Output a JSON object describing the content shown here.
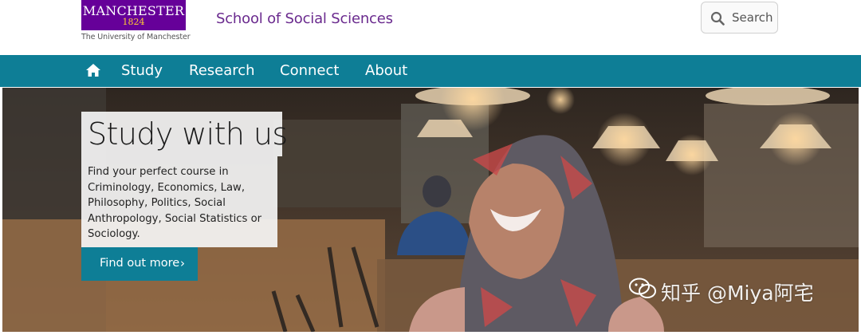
{
  "header": {
    "logo": {
      "wordmark": "MANCHESTER",
      "year": "1824",
      "subtitle": "The University of Manchester"
    },
    "school_name": "School of Social Sciences",
    "search": {
      "label": "Search",
      "icon": "search-icon"
    }
  },
  "nav": {
    "home_icon": "home-icon",
    "items": [
      {
        "label": "Study"
      },
      {
        "label": "Research"
      },
      {
        "label": "Connect"
      },
      {
        "label": "About"
      }
    ]
  },
  "hero": {
    "title": "Study with us",
    "body": "Find your perfect course in Criminology, Economics, Law, Philosophy, Politics, Social Anthropology, Social Statistics or Sociology.",
    "cta": {
      "label": "Find out more",
      "chevron": "›"
    }
  },
  "watermark": {
    "text": "知乎 @Miya阿宅"
  },
  "colors": {
    "brand_purple": "#660099",
    "logo_gold": "#ffcc33",
    "school_text": "#6a2a8e",
    "nav_teal": "#0e7e96"
  }
}
